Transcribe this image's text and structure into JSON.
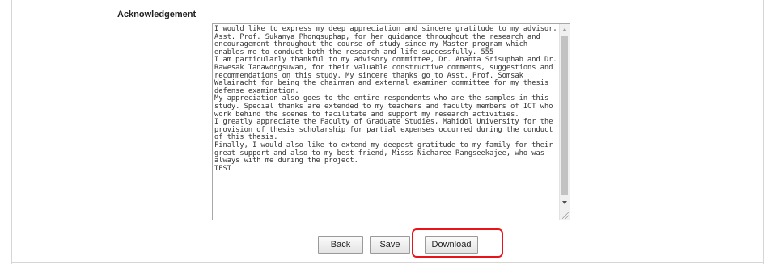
{
  "section": {
    "label": "Acknowledgement"
  },
  "acknowledgement_text": "I would like to express my deep appreciation and sincere gratitude to my advisor, Asst. Prof. Sukanya Phongsuphap, for her guidance throughout the research and encouragement throughout the course of study since my Master program which enables me to conduct both the research and life successfully. 555\nI am particularly thankful to my advisory committee, Dr. Ananta Srisuphab and Dr. Rawesak Tanawongsuwan, for their valuable constructive comments, suggestions and recommendations on this study. My sincere thanks go to Asst. Prof. Somsak Walairacht for being the chairman and external examiner committee for my thesis defense examination.\nMy appreciation also goes to the entire respondents who are the samples in this study. Special thanks are extended to my teachers and faculty members of ICT who work behind the scenes to facilitate and support my research activities.\nI greatly appreciate the Faculty of Graduate Studies, Mahidol University for the provision of thesis scholarship for partial expenses occurred during the conduct of this thesis.\nFinally, I would also like to extend my deepest gratitude to my family for their great support and also to my best friend, Misss Nicharee Rangseekajee, who was always with me during the project.\nTEST",
  "buttons": {
    "back": "Back",
    "save": "Save",
    "download": "Download"
  },
  "icons": {
    "scroll_up": "scroll-up-arrow-icon",
    "scroll_down": "scroll-down-arrow-icon",
    "resize": "resize-grip-icon"
  },
  "colors": {
    "highlight": "#e8141b"
  }
}
